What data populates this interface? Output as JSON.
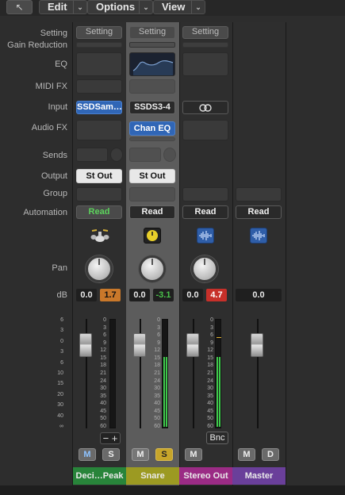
{
  "menubar": {
    "back_glyph": "↖",
    "edit": "Edit",
    "options": "Options",
    "view": "View"
  },
  "labels": {
    "setting": "Setting",
    "gain_reduction": "Gain Reduction",
    "eq": "EQ",
    "midi_fx": "MIDI FX",
    "input": "Input",
    "audio_fx": "Audio FX",
    "sends": "Sends",
    "output": "Output",
    "group": "Group",
    "automation": "Automation",
    "pan": "Pan",
    "db": "dB"
  },
  "channels": [
    {
      "name": "Deci…Peak",
      "setting": "Setting",
      "input": "SSDSam…",
      "audio_fx": "",
      "output": "St Out",
      "automation": "Read",
      "icon": "drum-kit-icon",
      "db_left": "0.0",
      "db_right": "1.7",
      "mute": "M",
      "solo": "S",
      "color": "#28843a",
      "meter_level": 0,
      "extra": "−  +"
    },
    {
      "name": "Snare",
      "setting": "Setting",
      "input": "SSDS3-4",
      "audio_fx": "Chan EQ",
      "output": "St Out",
      "automation": "Read",
      "icon": "tuner-icon",
      "db_left": "0.0",
      "db_right": "-3.1",
      "mute": "M",
      "solo": "S",
      "color": "#9c9a22",
      "meter_level": 0.78
    },
    {
      "name": "Stereo Out",
      "setting": "Setting",
      "input": "link-icon",
      "output": "",
      "automation": "Read",
      "icon": "waveform-icon",
      "db_left": "0.0",
      "db_right": "4.7",
      "mute": "M",
      "bnc": "Bnc",
      "color": "#9b2b85",
      "meter_level": 0.7
    },
    {
      "name": "Master",
      "automation": "Read",
      "icon": "waveform-icon",
      "db_left": "0.0",
      "mute": "M",
      "dim": "D",
      "color": "#6a3f9a",
      "meter_level": 0
    }
  ],
  "scale_left": [
    "6",
    "3",
    "0",
    "3",
    "6",
    "10",
    "15",
    "20",
    "30",
    "40",
    "∞"
  ],
  "scale_meter": [
    "0",
    "3",
    "6",
    "9",
    "12",
    "15",
    "18",
    "21",
    "24",
    "30",
    "35",
    "40",
    "45",
    "50",
    "60"
  ],
  "colors": {
    "blue_btn": "#3066b6",
    "orange_peak": "#c9782a",
    "red_peak": "#c7302a",
    "green_val": "#49c24a"
  }
}
